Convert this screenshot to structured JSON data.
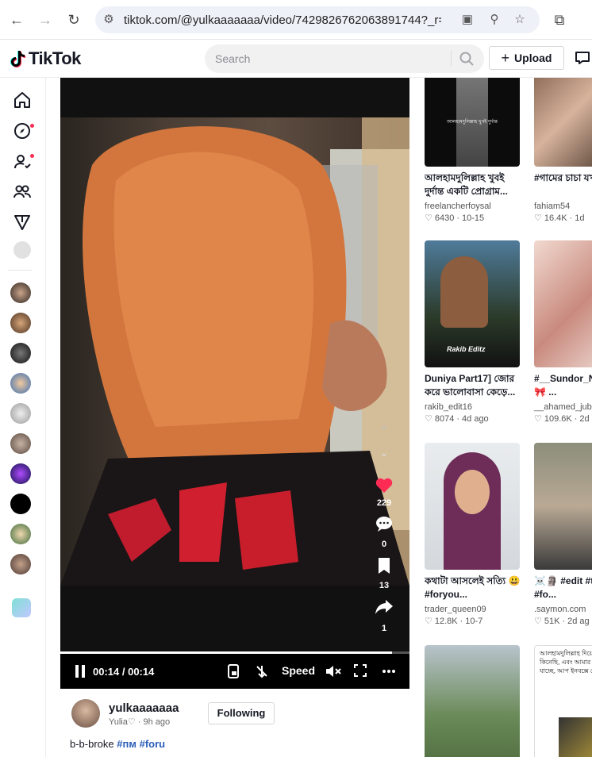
{
  "browser": {
    "url": "tiktok.com/@yulkaaaaaaa/video/7429826762063891744?_r=1&_t..."
  },
  "header": {
    "logo_text": "TikTok",
    "search_placeholder": "Search",
    "upload_label": "Upload"
  },
  "sidebar": {
    "icons": [
      "home-icon",
      "explore-icon",
      "following-icon",
      "friends-icon",
      "live-icon",
      "profile-icon"
    ],
    "followed_avatars_count": 10
  },
  "video": {
    "time": "00:14 / 00:14",
    "speed_label": "Speed",
    "progress_fraction": 0.95,
    "likes": "229",
    "comments": "0",
    "saves": "13",
    "shares": "1"
  },
  "author": {
    "username": "yulkaaaaaaa",
    "nickname": "Yulia♡",
    "time": "9h ago",
    "follow_label": "Following",
    "caption_text": "b-b-broke",
    "hashtags": [
      "#пм",
      "#foru"
    ]
  },
  "grid": {
    "items": [
      {
        "title": "আলহামদুলিল্লাহ খুবই দুর্দান্ত একটি প্রোগ্রাম...",
        "user": "freelancherfoysal",
        "likes": "6430",
        "date": "10-15"
      },
      {
        "title": "#গামের চাচা যখন পেমে...",
        "user": "fahiam54",
        "likes": "16.4K",
        "date": "1d"
      },
      {
        "title": "Duniya Part17] জোর করে ভালোবাসা কেড়ে...",
        "user": "rakib_edit16",
        "likes": "8074",
        "date": "4d ago"
      },
      {
        "title": "#__Sundor_N... ☁️🍫🎀 ...",
        "user": "__ahamed_jub",
        "likes": "109.6K",
        "date": "2d"
      },
      {
        "title": "কথাটা আসলেই সত্যি 😃#foryou...",
        "user": "trader_queen09",
        "likes": "12.8K",
        "date": "10-7"
      },
      {
        "title": "☠️🗿 #edit #trending #fo...",
        "user": ".saymon.com",
        "likes": "51K",
        "date": "2d ag"
      },
      {
        "title": "",
        "user": "",
        "likes": "",
        "date": ""
      },
      {
        "title": "",
        "user": "",
        "likes": "",
        "date": ""
      }
    ],
    "overlay_texts": {
      "rakib": "Rakib Editz",
      "top_post": "আলহামদুলিল্লাহ খুবই দুর্দান্ত",
      "bottom_post": "আলহামদুলিল্লাহ দিয়ে ফ্রিল্যান্সিং কিনেছি, এবং আমার অবস্থান দিকে যাচ্ছে, আপ ইনবক্সে মেসেজ"
    }
  },
  "colors": {
    "brand_red": "#fe2c55",
    "link_blue": "#2b5db9"
  }
}
